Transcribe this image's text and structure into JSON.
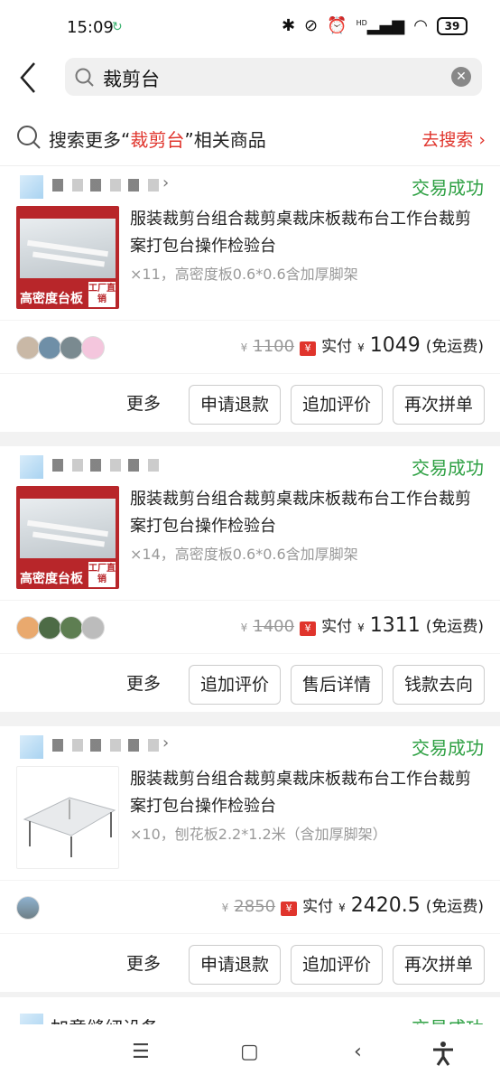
{
  "status_bar": {
    "time": "15:09",
    "battery": "39"
  },
  "search": {
    "query": "裁剪台"
  },
  "more_search": {
    "prefix": "搜索更多“",
    "keyword": "裁剪台",
    "suffix": "”相关商品",
    "action": "去搜索"
  },
  "orders": [
    {
      "status": "交易成功",
      "thumb_caption": "高密度台板",
      "thumb_badge": "工厂直销",
      "title": "服装裁剪台组合裁剪桌裁床板裁布台工作台裁剪案打包台操作检验台",
      "spec": "×11，高密度板0.6*0.6含加厚脚架",
      "original_price": "1100",
      "paid_label": "实付",
      "paid_amount": "1049",
      "shipping": "(免运费)",
      "more_label": "更多",
      "buttons": [
        "申请退款",
        "追加评价",
        "再次拼单"
      ]
    },
    {
      "status": "交易成功",
      "thumb_caption": "高密度台板",
      "thumb_badge": "工厂直销",
      "title": "服装裁剪台组合裁剪桌裁床板裁布台工作台裁剪案打包台操作检验台",
      "spec": "×14，高密度板0.6*0.6含加厚脚架",
      "original_price": "1400",
      "paid_label": "实付",
      "paid_amount": "1311",
      "shipping": "(免运费)",
      "more_label": "更多",
      "buttons": [
        "追加评价",
        "售后详情",
        "钱款去向"
      ]
    },
    {
      "status": "交易成功",
      "title": "服装裁剪台组合裁剪桌裁床板裁布台工作台裁剪案打包台操作检验台",
      "spec": "×10，刨花板2.2*1.2米（含加厚脚架）",
      "original_price": "2850",
      "paid_label": "实付",
      "paid_amount": "2420.5",
      "shipping": "(免运费)",
      "more_label": "更多",
      "buttons": [
        "申请退款",
        "追加评价",
        "再次拼单"
      ]
    }
  ],
  "partial_order": {
    "shop_name": "加意缝纫设备",
    "status": "交易成功"
  },
  "icons": {
    "back": "back-chevron-icon",
    "search": "search-icon",
    "clear": "clear-icon",
    "paid": "yen-icon",
    "nav": [
      "menu-icon",
      "home-square-icon",
      "back-icon",
      "accessibility-icon"
    ]
  },
  "colors": {
    "accent_red": "#e0342c",
    "success_green": "#2ea043"
  }
}
